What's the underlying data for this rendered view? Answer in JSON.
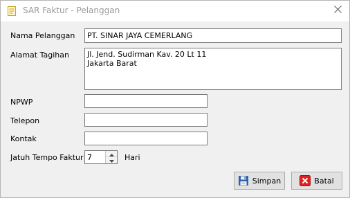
{
  "window": {
    "title": "SAR Faktur - Pelanggan"
  },
  "form": {
    "nama_label": "Nama Pelanggan",
    "nama_value": "PT. SINAR JAYA CEMERLANG",
    "alamat_label": "Alamat Tagihan",
    "alamat_value": "Jl. Jend. Sudirman Kav. 20 Lt 11\nJakarta Barat",
    "npwp_label": "NPWP",
    "npwp_value": "",
    "telepon_label": "Telepon",
    "telepon_value": "",
    "kontak_label": "Kontak",
    "kontak_value": "",
    "jatuh_tempo_label": "Jatuh Tempo Faktur",
    "jatuh_tempo_value": "7",
    "hari_label": "Hari"
  },
  "buttons": {
    "simpan_label": "Simpan",
    "batal_label": "Batal"
  },
  "icons": {
    "app": "document-icon",
    "close": "close-icon",
    "simpan": "floppy-disk-icon",
    "batal": "cancel-x-icon"
  },
  "colors": {
    "batal_icon": "#e02020",
    "simpan_icon": "#2f5fa8"
  }
}
